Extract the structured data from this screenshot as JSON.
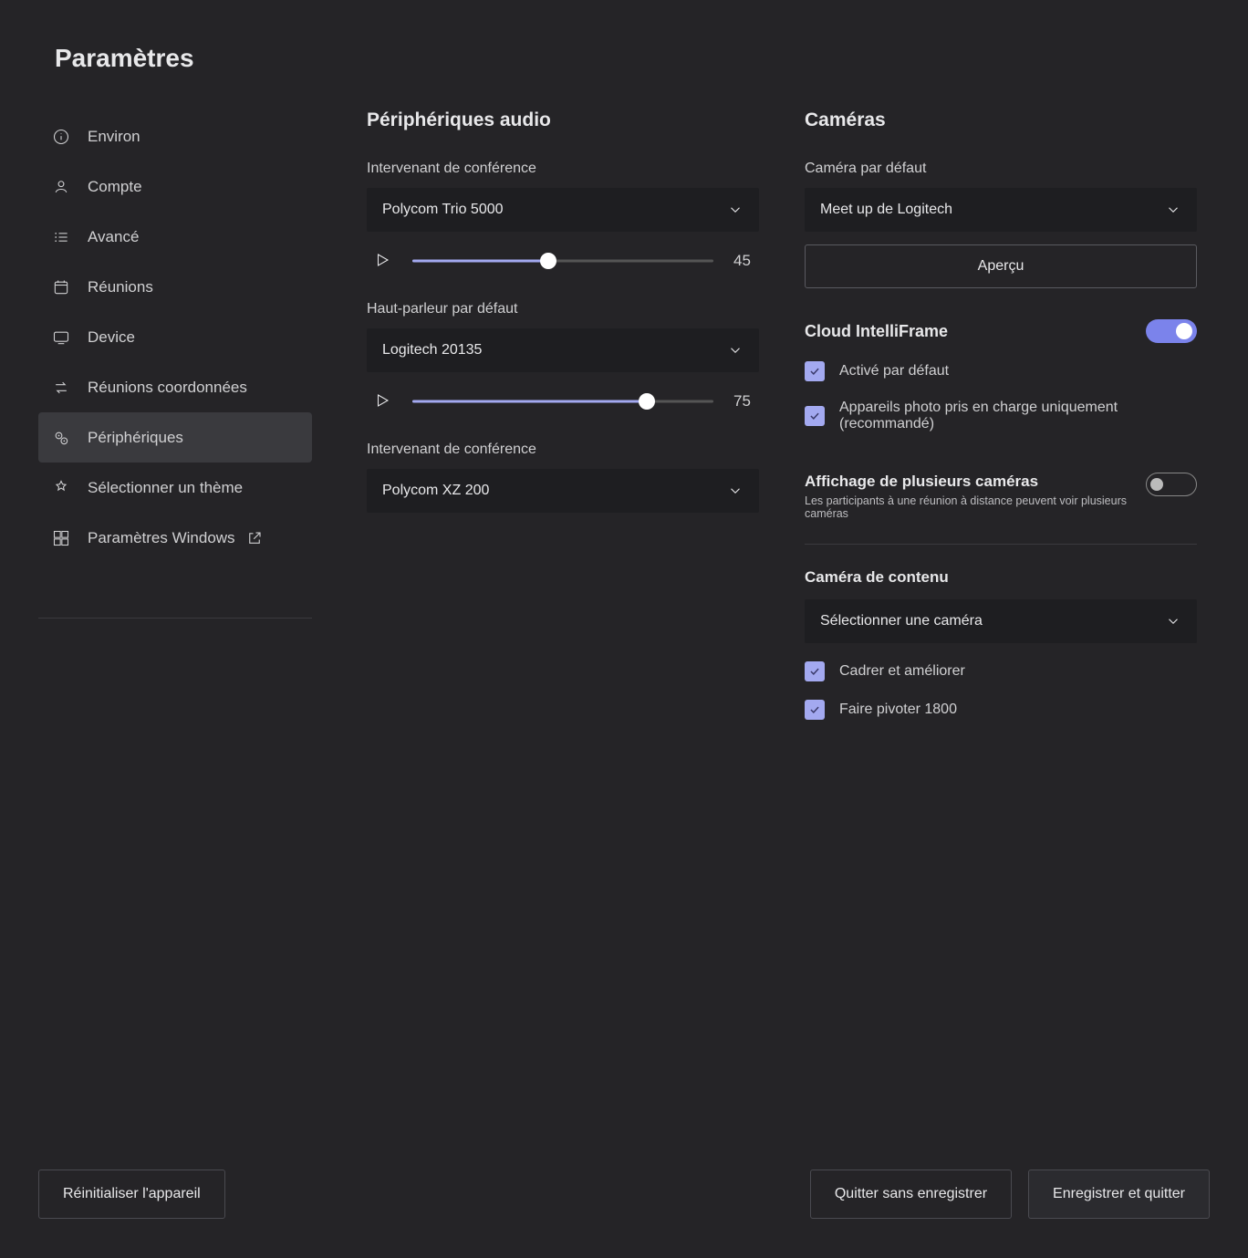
{
  "page_title": "Paramètres",
  "sidebar": {
    "items": [
      {
        "label": "Environ",
        "icon": "info"
      },
      {
        "label": "Compte",
        "icon": "account"
      },
      {
        "label": "Avancé",
        "icon": "list"
      },
      {
        "label": "Réunions",
        "icon": "calendar"
      },
      {
        "label": "Device",
        "icon": "display"
      },
      {
        "label": "Réunions coordonnées",
        "icon": "swap"
      },
      {
        "label": "Périphériques",
        "icon": "gear-dual"
      },
      {
        "label": "Sélectionner un thème",
        "icon": "theme"
      },
      {
        "label": "Paramètres Windows",
        "icon": "windows",
        "external": true
      }
    ],
    "active_index": 6
  },
  "audio": {
    "section_title": "Périphériques audio",
    "conference_speaker_label": "Intervenant de conférence",
    "conference_speaker_value": "Polycom Trio 5000",
    "conference_speaker_volume": 45,
    "default_speaker_label": "Haut-parleur par défaut",
    "default_speaker_value": "Logitech 20135",
    "default_speaker_volume": 75,
    "conference_mic_label": "Intervenant de conférence",
    "conference_mic_value": "Polycom XZ 200"
  },
  "cameras": {
    "section_title": "Caméras",
    "default_camera_label": "Caméra par défaut",
    "default_camera_value": "Meet up de Logitech",
    "preview_button": "Aperçu",
    "intelliframe_label": "Cloud IntelliFrame",
    "intelliframe_enabled": true,
    "intelliframe_default_on_label": "Activé par défaut",
    "intelliframe_default_on": true,
    "intelliframe_supported_only_label": "Appareils photo pris en charge uniquement (recommandé)",
    "intelliframe_supported_only": true,
    "multi_view_label": "Affichage de plusieurs caméras",
    "multi_view_sub": "Les participants à une réunion à distance peuvent voir plusieurs caméras",
    "multi_view_enabled": false,
    "content_camera_label": "Caméra de contenu",
    "content_camera_value": "Sélectionner une caméra",
    "crop_enhance_label": "Cadrer et améliorer",
    "crop_enhance": true,
    "rotate_1800_label": "Faire pivoter 1800",
    "rotate_1800": true
  },
  "footer": {
    "reset_device": "Réinitialiser l'appareil",
    "exit_no_save": "Quitter sans enregistrer",
    "save_exit": "Enregistrer et quitter"
  }
}
